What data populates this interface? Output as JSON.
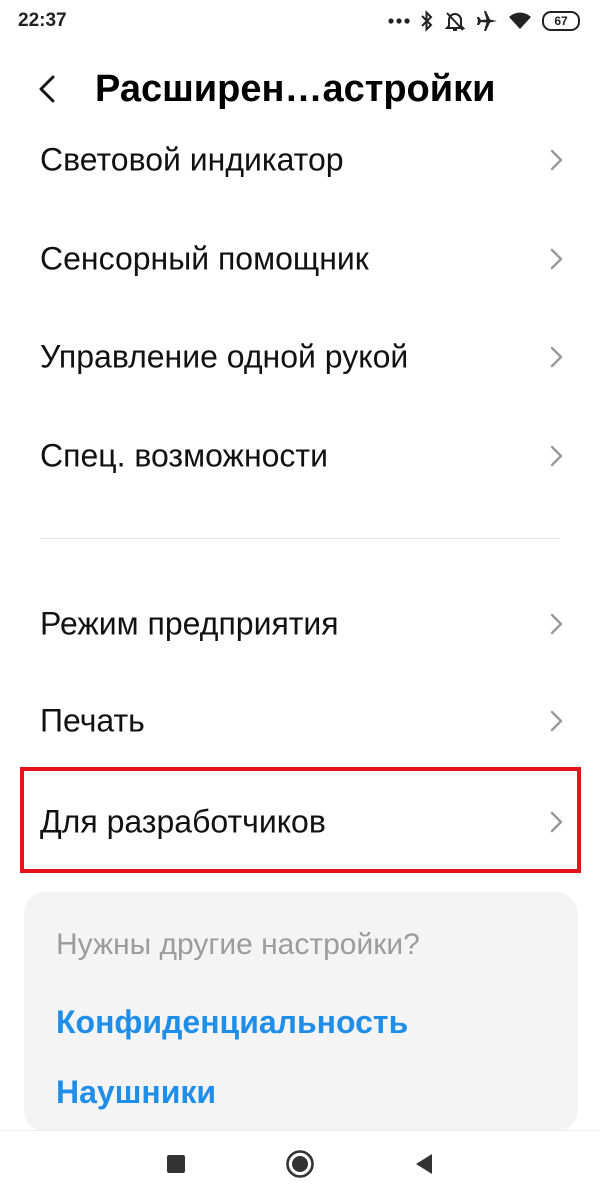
{
  "status_bar": {
    "time": "22:37",
    "icons": [
      "more-dots-icon",
      "bluetooth-icon",
      "bell-muted-icon",
      "airplane-icon",
      "wifi-icon",
      "battery-icon"
    ],
    "battery": "67"
  },
  "header": {
    "title": "Расширен…астройки",
    "back_icon": "chevron-left-icon"
  },
  "settings": {
    "items": [
      {
        "label": "Световой индикатор"
      },
      {
        "label": "Сенсорный помощник"
      },
      {
        "label": "Управление одной рукой"
      },
      {
        "label": "Спец. возможности"
      },
      {
        "label": "Режим предприятия"
      },
      {
        "label": "Печать"
      },
      {
        "label": "Для разработчиков"
      }
    ]
  },
  "highlight_color": "#e8121b",
  "suggestions": {
    "title": "Нужны другие настройки?",
    "links": [
      {
        "label": "Конфиденциальность"
      },
      {
        "label": "Наушники"
      }
    ],
    "link_color": "#1f8ee8"
  },
  "nav_bar": {
    "icons": [
      "recent-apps-icon",
      "home-icon",
      "back-triangle-icon"
    ]
  }
}
